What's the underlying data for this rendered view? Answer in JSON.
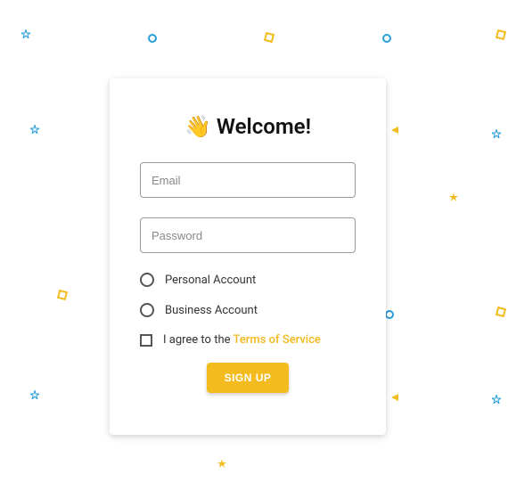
{
  "title": {
    "emoji": "👋",
    "text": "Welcome!"
  },
  "form": {
    "email_placeholder": "Email",
    "password_placeholder": "Password",
    "option_personal": "Personal Account",
    "option_business": "Business Account",
    "agree_prefix": "I agree to the",
    "tos_link": "Terms of Service",
    "signup_label": "SIGN UP"
  },
  "colors": {
    "accent": "#f3bb1d",
    "confetti_blue": "#2a9fd9",
    "confetti_gold": "#f3bb1d"
  }
}
